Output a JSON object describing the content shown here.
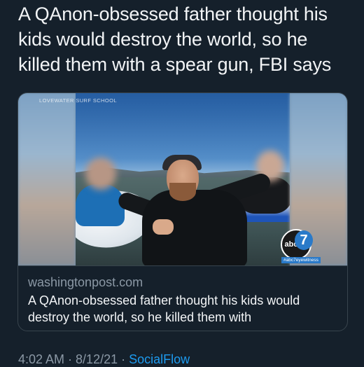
{
  "tweet": {
    "text": "A QAnon-obsessed father thought his kids would destroy the world, so he killed them with a spear gun, FBI says"
  },
  "card": {
    "image": {
      "watermark": "LOVEWATER SURF SCHOOL",
      "broadcaster_logo": "abc",
      "broadcaster_number": "7",
      "hashtag": "#abc7eyewitness"
    },
    "domain": "washingtonpost.com",
    "title": "A QAnon-obsessed father thought his kids would destroy the world, so he killed them with"
  },
  "meta": {
    "time": "4:02 AM",
    "separator": " · ",
    "date": "8/12/21",
    "source": "SocialFlow"
  },
  "colors": {
    "background": "#15202b",
    "secondary_text": "#8b98a5",
    "link": "#1d9bf0",
    "border": "#38444d"
  }
}
